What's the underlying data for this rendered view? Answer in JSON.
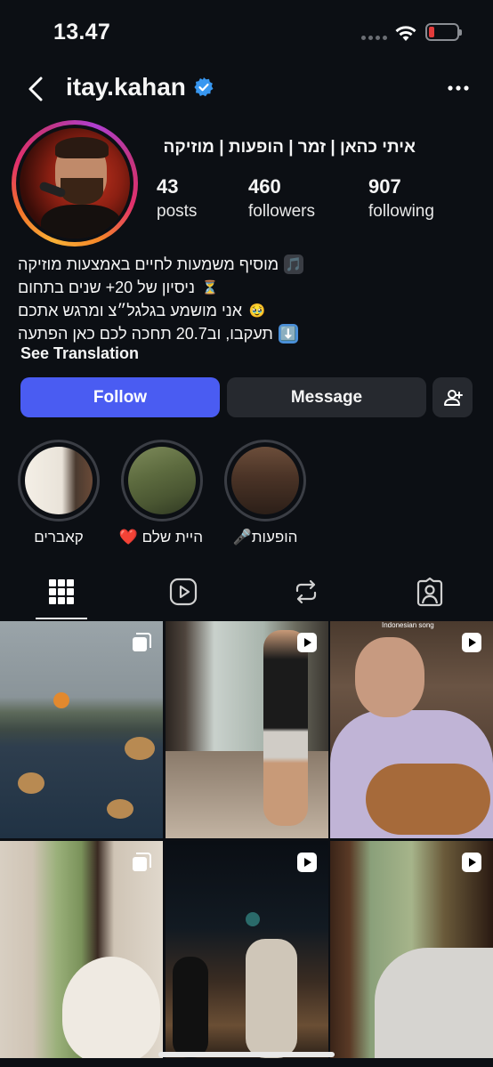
{
  "status_bar": {
    "time": "13.47"
  },
  "header": {
    "username": "itay.kahan"
  },
  "profile": {
    "display_name": "איתי כהאן | זמר | הופעות | מוזיקה",
    "stats": [
      {
        "value": "43",
        "label": "posts"
      },
      {
        "value": "460",
        "label": "followers"
      },
      {
        "value": "907",
        "label": "following"
      }
    ],
    "bio": [
      {
        "text": "מוסיף משמעות לחיים באמצעות מוזיקה",
        "emoji": "🎵"
      },
      {
        "text": "ניסיון של 20+ שנים בתחום",
        "emoji": "⏳"
      },
      {
        "text": "אני מושמע בגלגל״צ ומרגש אתכם",
        "emoji": "🥹"
      },
      {
        "text": "תעקבו, וב20.7 תחכה לכם כאן הפתעה",
        "emoji": "⬇️"
      }
    ],
    "see_translation": "See Translation"
  },
  "actions": {
    "follow": "Follow",
    "message": "Message"
  },
  "highlights": [
    {
      "label": "קאברים"
    },
    {
      "label": "היית שלם ❤️"
    },
    {
      "label": "הופעות🎤"
    }
  ],
  "tabs": [
    "grid-icon",
    "reels-icon",
    "reposts-icon",
    "tagged-icon"
  ],
  "grid": [
    {
      "type": "carousel"
    },
    {
      "type": "reel"
    },
    {
      "type": "reel",
      "overlay_text": "Indonesian song"
    },
    {
      "type": "carousel"
    },
    {
      "type": "reel"
    },
    {
      "type": "reel"
    }
  ],
  "colors": {
    "background": "#0c0f14",
    "follow_button": "#4a5cf2",
    "secondary_button": "#26292f",
    "verified": "#3897f0"
  }
}
